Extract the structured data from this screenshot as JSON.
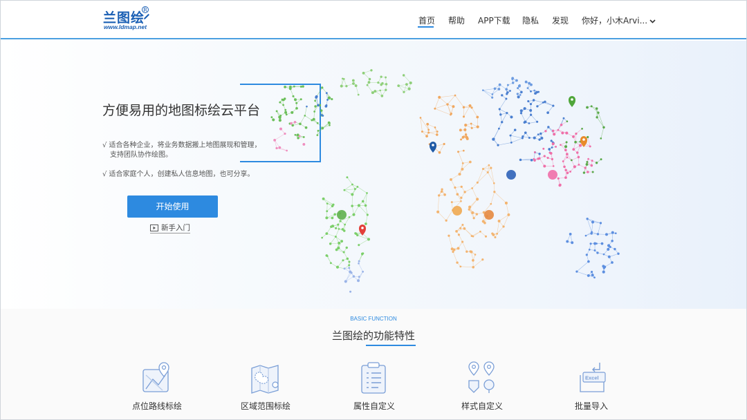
{
  "header": {
    "logo_text": "兰图绘",
    "logo_reg": "R",
    "logo_url": "www.ldmap.net",
    "nav": [
      {
        "label": "首页"
      },
      {
        "label": "帮助"
      },
      {
        "label": "APP下载"
      },
      {
        "label": "隐私"
      },
      {
        "label": "发现"
      }
    ],
    "user": "你好，小木Arvi..."
  },
  "hero": {
    "title": "方便易用的地图标绘云平台",
    "line1": "√ 适合各种企业，将业务数据搬上地图展现和管理，",
    "line2": "支持团队协作绘图。",
    "line3": "√ 适合家庭个人，创建私人信息地图，也可分享。",
    "start_button": "开始使用",
    "guide_link": "新手入门"
  },
  "features": {
    "subtitle": "BASIC FUNCTION",
    "title": "兰图绘的功能特性",
    "items": [
      {
        "label": "点位路线标绘",
        "icon": "route-pin-icon"
      },
      {
        "label": "区域范围标绘",
        "icon": "region-map-icon"
      },
      {
        "label": "属性自定义",
        "icon": "clipboard-list-icon"
      },
      {
        "label": "样式自定义",
        "icon": "marker-styles-icon"
      },
      {
        "label": "批量导入",
        "icon": "excel-import-icon"
      }
    ]
  },
  "colors": {
    "accent": "#2d8ae0",
    "brand": "#1a5fb4",
    "map_green": "#6cbf5a",
    "map_orange": "#f0a050",
    "map_blue": "#4a7fd0",
    "map_pink": "#ef6fa8"
  }
}
